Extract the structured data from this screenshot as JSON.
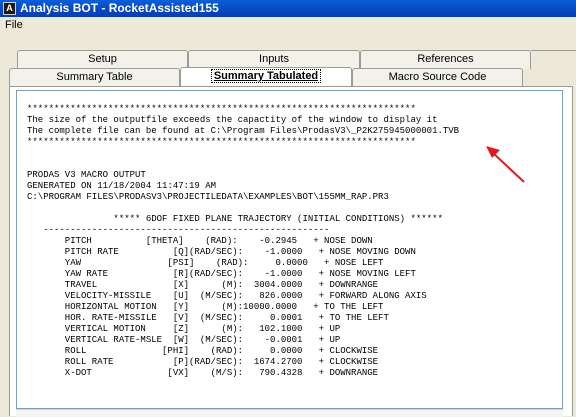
{
  "window": {
    "icon_glyph": "A",
    "title": "Analysis BOT - RocketAssisted155",
    "accent": "#0a5fd8"
  },
  "menu": {
    "file": "File"
  },
  "tabs": {
    "row1": [
      "Setup",
      "Inputs",
      "References"
    ],
    "row2": [
      "Summary Table",
      "Summary Tabulated",
      "Macro Source Code"
    ],
    "active": "Summary Tabulated"
  },
  "output": {
    "stars": "************************************************************************",
    "notice_1": "The size of the outputfile exceeds the capactity of the window to display it",
    "notice_2": "The complete file can be found at C:\\Program Files\\ProdasV3\\_P2K275945000001.TVB",
    "macro_title": "PRODAS V3 MACRO OUTPUT",
    "generated": "GENERATED ON 11/18/2004 11:47:19 AM",
    "path": "C:\\PROGRAM FILES\\PRODASV3\\PROJECTILEDATA\\EXAMPLES\\BOT\\155MM_RAP.PR3",
    "section_title": "                ***** 6DOF FIXED PLANE TRAJECTORY (INITIAL CONDITIONS) ******",
    "rule": "   -----------------------------------------------------",
    "rows": [
      "       PITCH          [THETA]    (RAD):    -0.2945   + NOSE DOWN",
      "       PITCH RATE          [Q](RAD/SEC):    -1.0000   + NOSE MOVING DOWN",
      "       YAW                [PSI]    (RAD):     0.0000   + NOSE LEFT",
      "       YAW RATE            [R](RAD/SEC):    -1.0000   + NOSE MOVING LEFT",
      "       TRAVEL              [X]      (M):  3004.0000   + DOWNRANGE",
      "       VELOCITY-MISSILE    [U]  (M/SEC):   826.0000   + FORWARD ALONG AXIS",
      "       HORIZONTAL MOTION   [Y]      (M):10000.0000   + TO THE LEFT",
      "       HOR. RATE-MISSILE   [V]  (M/SEC):     0.0001   + TO THE LEFT",
      "       VERTICAL MOTION     [Z]      (M):   102.1000   + UP",
      "       VERTICAL RATE-MSLE  [W]  (M/SEC):    -0.0001   + UP",
      "       ROLL              [PHI]    (RAD):     0.0000   + CLOCKWISE",
      "       ROLL RATE           [P](RAD/SEC):  1674.2700   + CLOCKWISE",
      "       X-DOT              [VX]    (M/S):   790.4328   + DOWNRANGE"
    ]
  },
  "annotation": {
    "arrow_color": "#e01b1b"
  }
}
